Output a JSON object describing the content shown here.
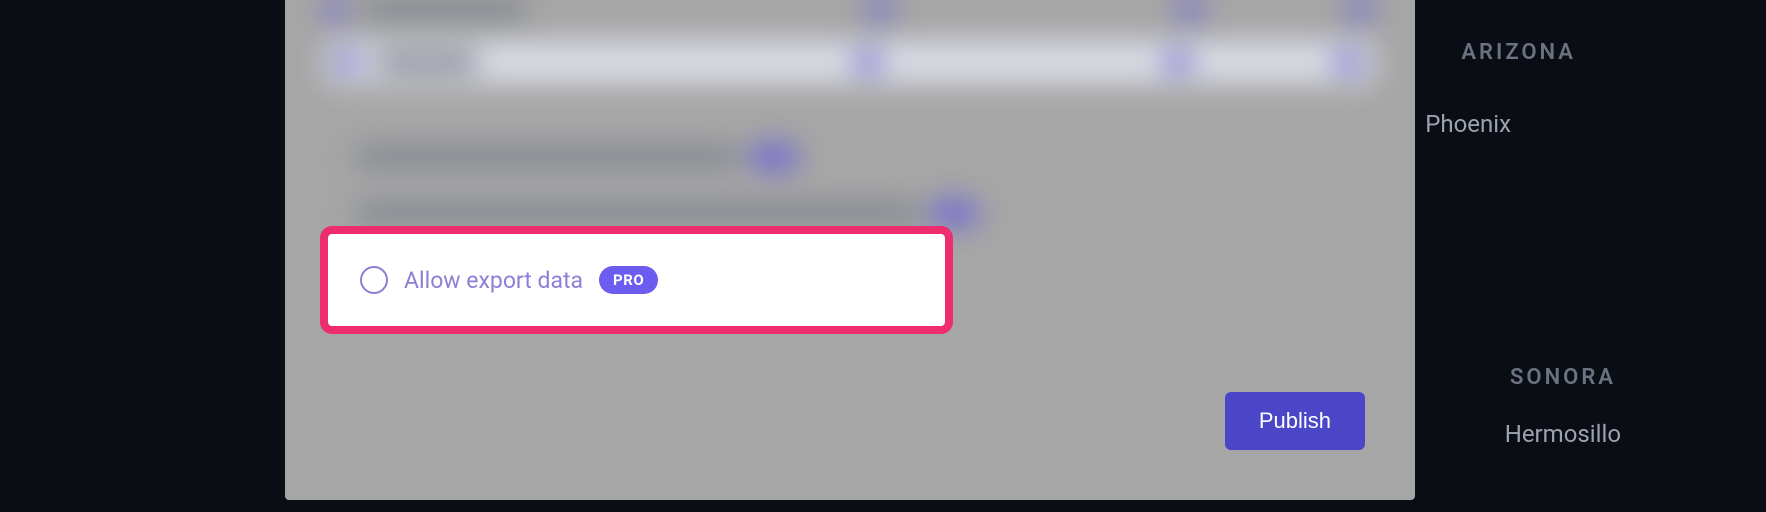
{
  "map": {
    "labels": {
      "arizona": "ARIZONA",
      "phoenix": "Phoenix",
      "sonora": "SONORA",
      "hermosillo": "Hermosillo"
    }
  },
  "modal": {
    "options": {
      "allow_export": {
        "label": "Allow export data",
        "badge": "PRO"
      }
    },
    "buttons": {
      "publish": "Publish"
    }
  }
}
